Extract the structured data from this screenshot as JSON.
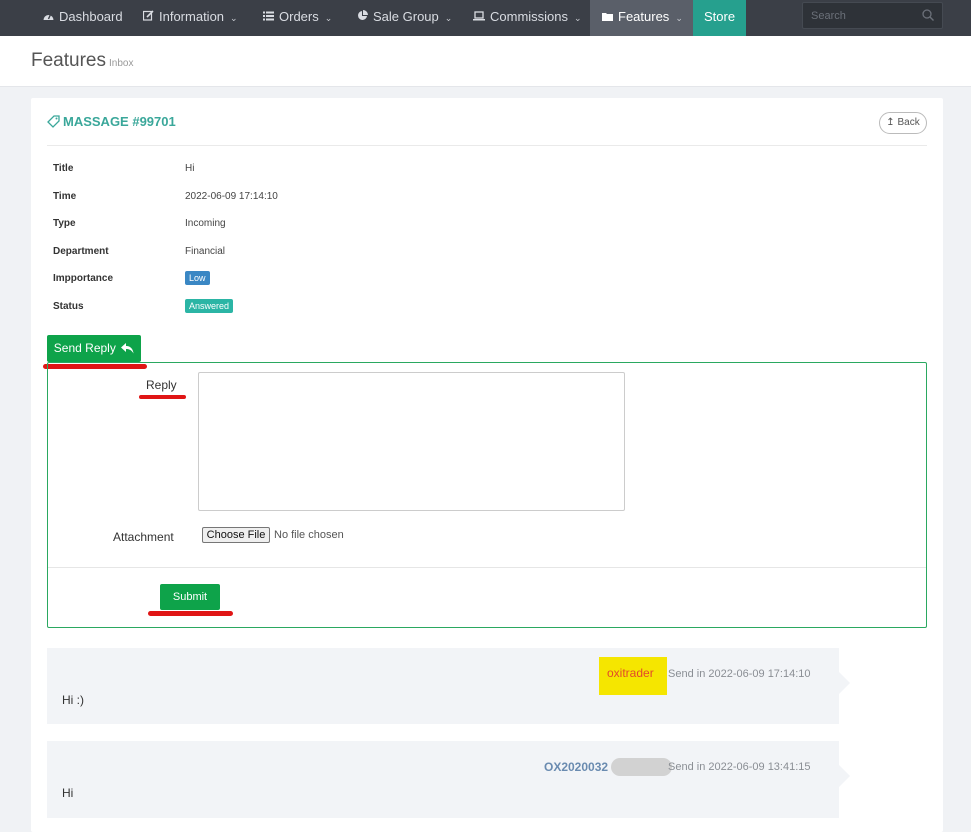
{
  "nav": {
    "items": [
      {
        "label": "Dashboard",
        "icon": "dashboard-icon"
      },
      {
        "label": "Information",
        "icon": "edit-icon"
      },
      {
        "label": "Orders",
        "icon": "list-icon"
      },
      {
        "label": "Sale Group",
        "icon": "pie-chart-icon"
      },
      {
        "label": "Commissions",
        "icon": "laptop-icon"
      },
      {
        "label": "Features",
        "icon": "folder-icon"
      },
      {
        "label": "Store"
      }
    ],
    "search_placeholder": "Search"
  },
  "header": {
    "title": "Features",
    "subtitle": "Inbox"
  },
  "card": {
    "title": "MASSAGE #99701",
    "back_label": "Back",
    "fields": {
      "title_label": "Title",
      "title_value": "Hi",
      "time_label": "Time",
      "time_value": "2022-06-09 17:14:10",
      "type_label": "Type",
      "type_value": "Incoming",
      "department_label": "Department",
      "department_value": "Financial",
      "importance_label": "Impportance",
      "importance_value": "Low",
      "status_label": "Status",
      "status_value": "Answered"
    }
  },
  "reply": {
    "send_reply_label": "Send Reply",
    "reply_label": "Reply",
    "reply_value": "",
    "attachment_label": "Attachment",
    "choose_file_label": "Choose File",
    "file_status": "No file chosen",
    "submit_label": "Submit"
  },
  "messages": [
    {
      "sender": "oxitrader",
      "meta": "Send in 2022-06-09 17:14:10",
      "body": "Hi :)"
    },
    {
      "sender": "OX2020032",
      "meta": "Send in 2022-06-09 13:41:15",
      "body": "Hi"
    }
  ],
  "colors": {
    "accent": "#3aa79a",
    "primary_button": "#0ea34a",
    "nav_bg": "#3b3f47",
    "store": "#26a08e",
    "highlight": "#f5e600",
    "annotation": "#e01515"
  }
}
